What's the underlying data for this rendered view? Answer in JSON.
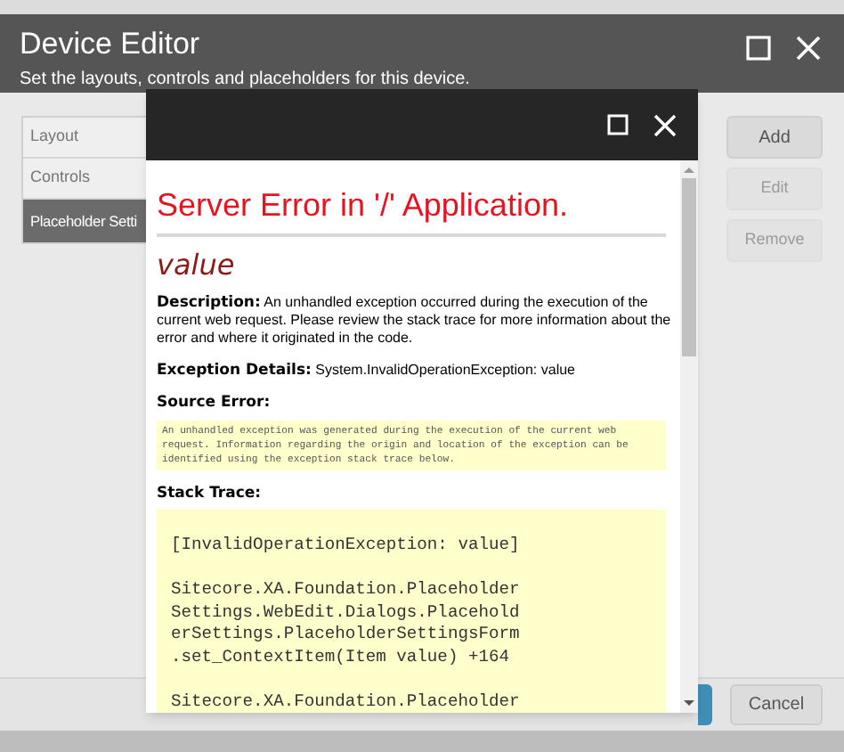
{
  "dialog": {
    "title": "Device Editor",
    "subtitle": "Set the layouts, controls and placeholders for this device."
  },
  "tabs": [
    {
      "label": "Layout",
      "selected": false
    },
    {
      "label": "Controls",
      "selected": false
    },
    {
      "label": "Placeholder Setti",
      "selected": true
    }
  ],
  "buttons": [
    {
      "label": "Add",
      "disabled": false
    },
    {
      "label": "Edit",
      "disabled": true
    },
    {
      "label": "Remove",
      "disabled": true
    }
  ],
  "footer_buttons": [
    {
      "kind": "primary"
    },
    {
      "kind": "secondary",
      "label": "Cancel"
    }
  ],
  "error_window": {
    "heading": "Server Error in '/' Application.",
    "message": "value",
    "description": {
      "label": "Description:",
      "text": "An unhandled exception occurred during the execution of the current web request. Please review the stack trace for more information about the error and where it originated in the code."
    },
    "exception": {
      "label": "Exception Details:",
      "text": "System.InvalidOperationException: value"
    },
    "source_error": {
      "label": "Source Error:",
      "text": "An unhandled exception was generated during the execution of the current web request. Information regarding the origin and location of the exception can be identified using the exception stack trace below."
    },
    "stack_trace": {
      "label": "Stack Trace:",
      "blocks": [
        [
          "[InvalidOperationException: value]"
        ],
        [
          "Sitecore.XA.Foundation.Placeholder",
          "Settings.WebEdit.Dialogs.Placehold",
          "erSettings.PlaceholderSettingsForm",
          ".set_ContextItem(Item value) +164"
        ],
        [
          "Sitecore.XA.Foundation.Placeholder"
        ]
      ]
    }
  }
}
